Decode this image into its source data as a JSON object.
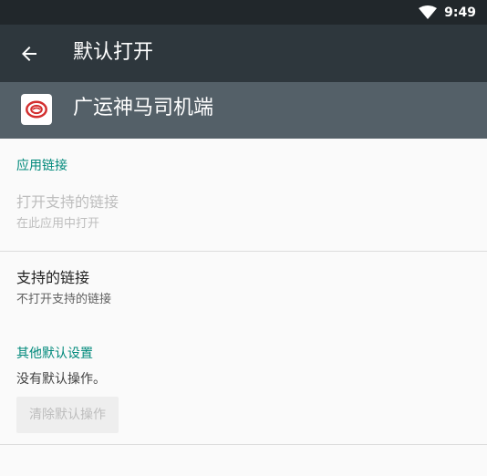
{
  "status_bar": {
    "time": "9:49"
  },
  "toolbar": {
    "title": "默认打开"
  },
  "app": {
    "name": "广运神马司机端"
  },
  "app_links": {
    "section_title": "应用链接",
    "open_supported": {
      "title": "打开支持的链接",
      "subtitle": "在此应用中打开"
    },
    "supported_links": {
      "title": "支持的链接",
      "subtitle": "不打开支持的链接"
    }
  },
  "other_defaults": {
    "section_title": "其他默认设置",
    "message": "没有默认操作。",
    "clear_button": "清除默认操作"
  },
  "colors": {
    "accent": "#00897b",
    "toolbar": "#2e373d",
    "app_header": "#546068",
    "status_bar": "#21272b"
  }
}
